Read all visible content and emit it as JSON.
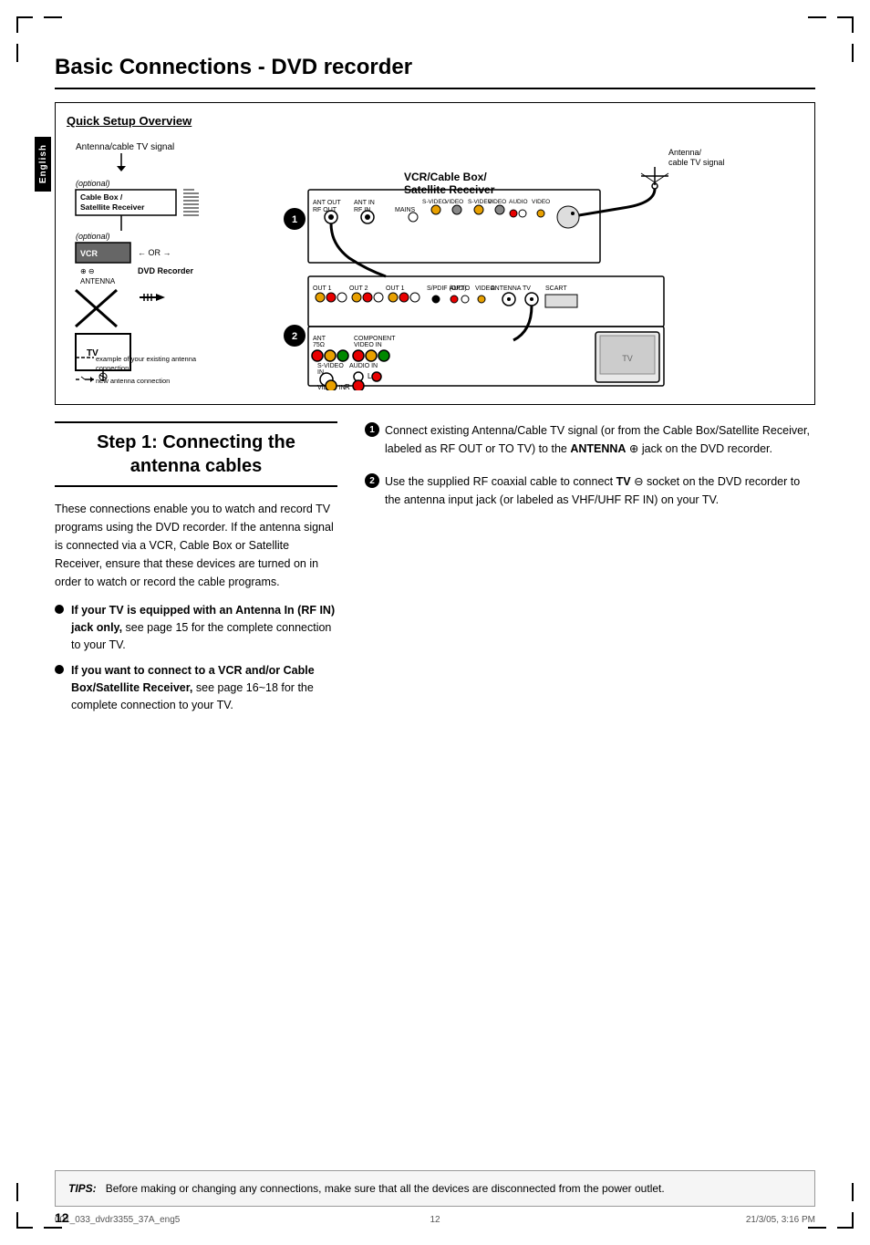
{
  "page": {
    "title": "Basic Connections - DVD recorder",
    "number": "12",
    "footer_code": "001_033_dvdr3355_37A_eng5",
    "footer_page": "12",
    "footer_date": "21/3/05, 3:16 PM"
  },
  "sidebar": {
    "label": "English"
  },
  "diagram": {
    "title": "Quick Setup Overview",
    "left_label1": "Antenna/cable TV signal",
    "left_optional1": "(optional)",
    "left_device1": "Cable Box / Satellite Receiver",
    "left_optional2": "(optional)",
    "left_device2": "VCR",
    "left_device3": "DVD Recorder",
    "left_device4": "TV",
    "legend_existing": "example of your existing antenna connection",
    "legend_new": "new antenna connection",
    "right_device1": "VCR/Cable Box/ Satellite Receiver",
    "right_label1": "Antenna/ cable TV signal",
    "right_device2": "TV",
    "circle1": "1",
    "circle2": "2"
  },
  "step": {
    "number": "1",
    "title1": "Step 1:  Connecting the",
    "title2": "antenna cables",
    "body": "These connections enable you to watch and record TV programs using the DVD recorder.  If the antenna signal is connected via a VCR, Cable Box or Satellite Receiver, ensure that these devices are turned on in order to watch or record the cable programs.",
    "bullet1_heading": "If your TV is equipped with an Antenna In (RF IN) jack only,",
    "bullet1_body": "see page 15 for the complete connection to your TV.",
    "bullet2_heading": "If you want to connect to a VCR and/or Cable Box/Satellite Receiver,",
    "bullet2_body": "see page 16~18 for the complete connection to your TV."
  },
  "instructions": {
    "item1": "Connect existing Antenna/Cable TV signal (or from the Cable Box/Satellite Receiver, labeled as RF OUT or TO TV) to the ANTENNA  jack on the DVD recorder.",
    "item1_bold": "ANTENNA",
    "item2_pre": "Use the supplied RF coaxial cable to connect",
    "item2_bold": "TV",
    "item2_post": "socket on the DVD recorder to the antenna input jack (or labeled as VHF/UHF RF IN) on your TV."
  },
  "tips": {
    "label": "TIPS:",
    "text": "Before making or changing any connections, make sure that all the devices are disconnected from the power outlet."
  }
}
